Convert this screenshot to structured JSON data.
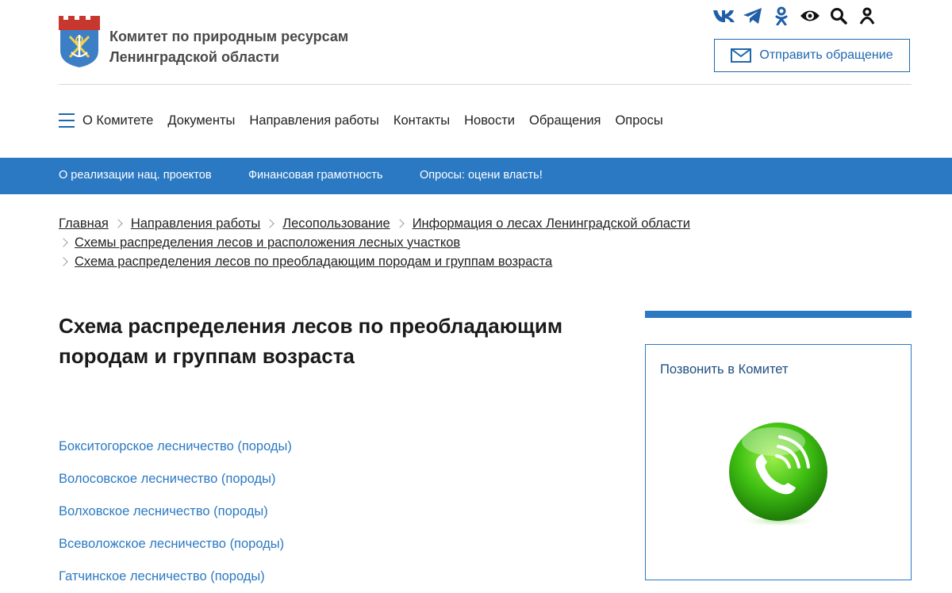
{
  "header": {
    "org_line1": "Комитет по природным ресурсам",
    "org_line2": "Ленинградской области",
    "icons": [
      "vk-icon",
      "telegram-icon",
      "odnoklassniki-icon",
      "eye-icon",
      "search-icon",
      "user-icon"
    ],
    "appeal_button": "Отправить обращение"
  },
  "main_nav": {
    "items": [
      "О Комитете",
      "Документы",
      "Направления работы",
      "Контакты",
      "Новости",
      "Обращения",
      "Опросы"
    ]
  },
  "blue_bar": {
    "items": [
      "О реализации нац. проектов",
      "Финансовая грамотность",
      "Опросы: оцени власть!"
    ]
  },
  "breadcrumbs": {
    "items": [
      "Главная",
      "Направления работы",
      "Лесопользование",
      "Информация о лесах Ленинградской области",
      "Схемы распределения лесов и расположения лесных участков",
      "Схема распределения лесов по преобладающим породам и группам возраста"
    ]
  },
  "page": {
    "title_line1": "Схема распределения лесов по преобладающим",
    "title_line2": "породам и группам возраста",
    "links": [
      "Бокситогорское лесничество (породы)",
      "Волосовское лесничество (породы)",
      "Волховское лесничество (породы)",
      "Всеволожское лесничество (породы)",
      "Гатчинское лесничество (породы)"
    ]
  },
  "sidebar": {
    "call_title": "Позвонить в Комитет"
  },
  "colors": {
    "accent": "#2b79c2",
    "dark_accent": "#1f67ad",
    "phone_green": "#3fc012"
  }
}
